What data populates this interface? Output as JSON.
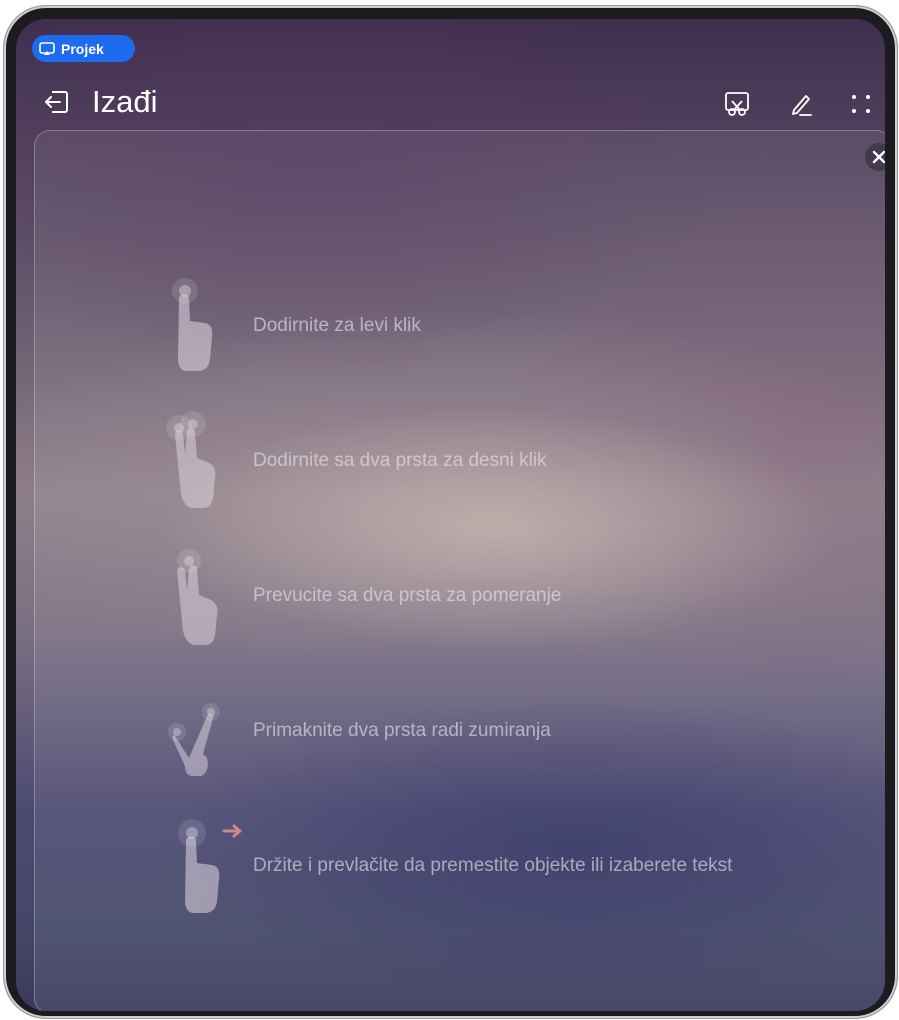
{
  "badge": {
    "label": "Projek"
  },
  "header": {
    "title": "Izađi"
  },
  "toolbar": {
    "icons": [
      "exit-icon",
      "screenshot-scissors-icon",
      "pen-annotate-icon",
      "more-dots-icon"
    ]
  },
  "tips": [
    {
      "text": "Dodirnite za levi klik",
      "icon": "one-finger-tap-icon"
    },
    {
      "text": "Dodirnite sa dva prsta za desni klik",
      "icon": "two-finger-tap-icon"
    },
    {
      "text": "Prevucite sa dva prsta za pomeranje",
      "icon": "two-finger-scroll-icon"
    },
    {
      "text": "Primaknite dva prsta radi zumiranja",
      "icon": "pinch-zoom-icon"
    },
    {
      "text": "Držite i prevlačite da premestite objekte ili izaberete tekst",
      "icon": "press-drag-icon"
    }
  ],
  "colors": {
    "badge": "#1f6bf0",
    "text": "#ffffff"
  }
}
